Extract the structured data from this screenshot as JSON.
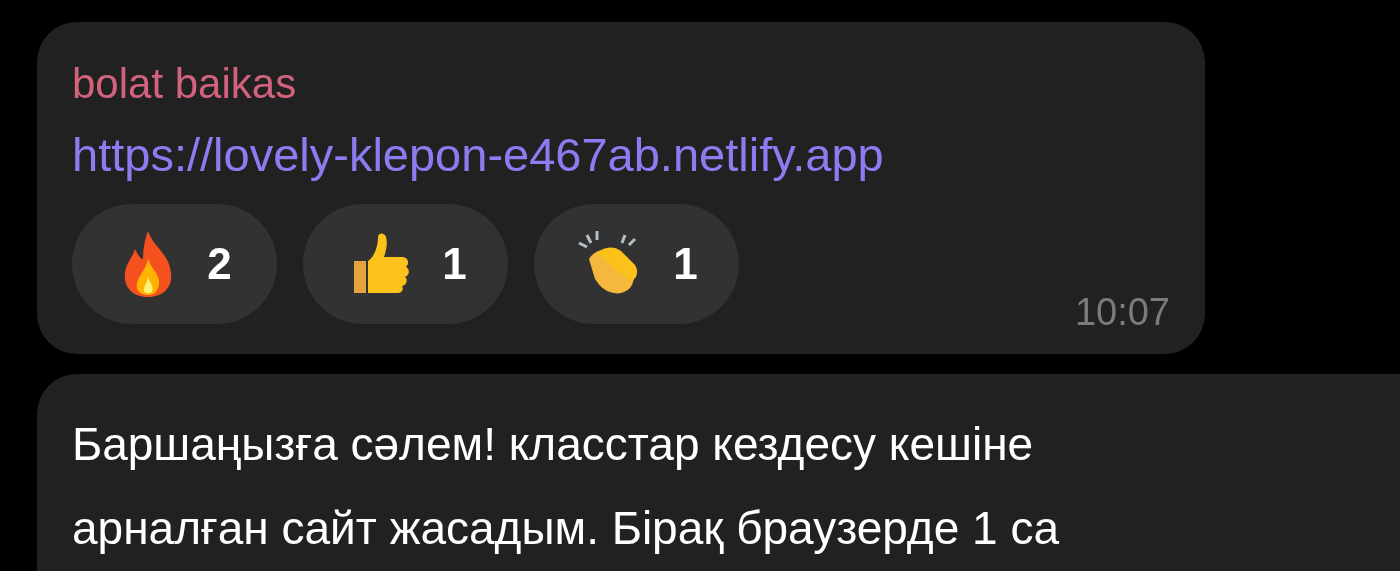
{
  "messages": [
    {
      "kind": "link",
      "sender": "bolat baikas",
      "link": "https://lovely-klepon-e467ab.netlify.app",
      "reactions": [
        {
          "kind": "fire",
          "count": "2"
        },
        {
          "kind": "thumbs-up",
          "count": "1"
        },
        {
          "kind": "clap",
          "count": "1"
        }
      ],
      "time": "10:07"
    },
    {
      "kind": "text",
      "lines": [
        "Баршаңызға сәлем! класстар кездесу кешіне",
        "арналған сайт жасадым. Бірақ браузерде 1 са"
      ]
    }
  ]
}
